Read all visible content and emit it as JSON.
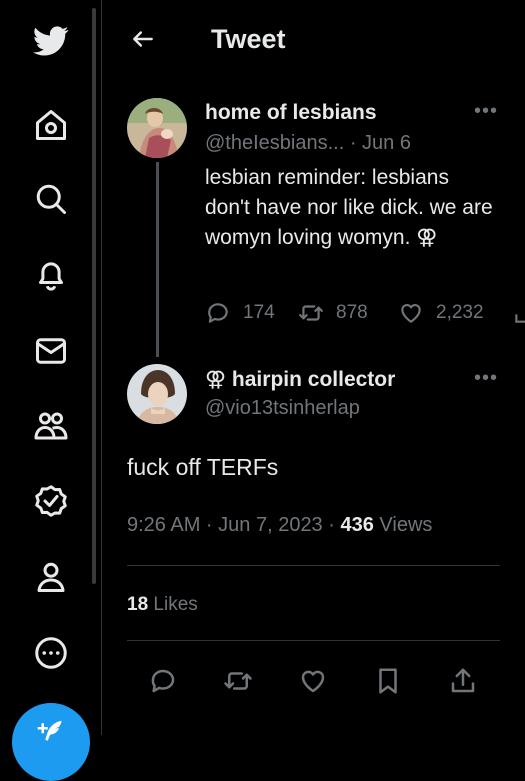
{
  "header": {
    "title": "Tweet"
  },
  "sidebar": {
    "items": [
      "twitter-logo",
      "home",
      "explore",
      "notifications",
      "messages",
      "communities",
      "verified",
      "profile",
      "more"
    ]
  },
  "quoted_tweet": {
    "name": "home of lesbians",
    "handle": "@theIesbians...",
    "date": "· Jun 6",
    "text": "lesbian reminder: lesbians don't have nor like dick. we are womyn loving womyn. ⚢",
    "replies": "174",
    "retweets": "878",
    "likes": "2,232"
  },
  "main_tweet": {
    "name": "⚢ hairpin collector",
    "handle": "@vio13tsinherlap",
    "text": "fuck off TERFs",
    "time": "9:26 AM · Jun 7, 2023 ·",
    "views_count": "436",
    "views_label": "Views",
    "likes_count": "18",
    "likes_label": "Likes"
  },
  "colors": {
    "background": "#000000",
    "text": "#e7e9ea",
    "muted": "#71767b",
    "accent": "#1d9bf0",
    "divider": "#2f3336"
  }
}
